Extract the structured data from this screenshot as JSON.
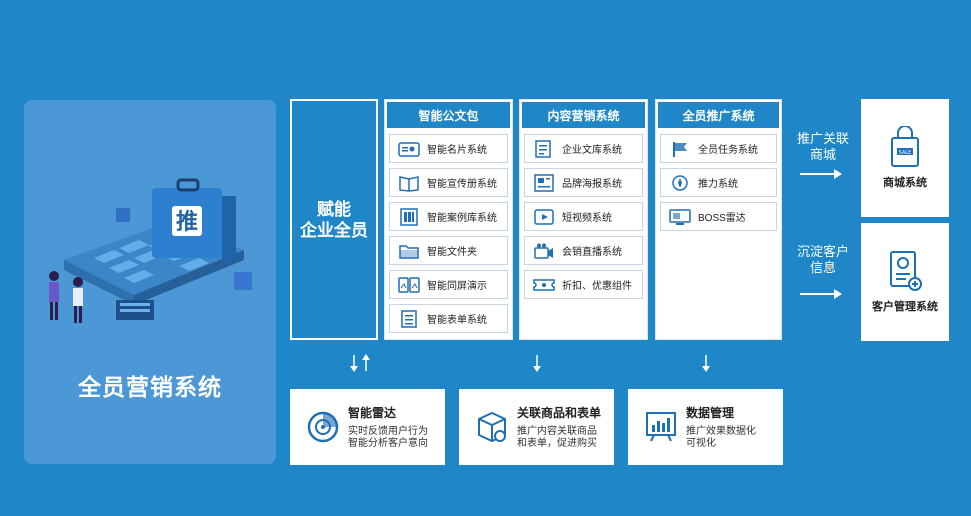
{
  "hero": {
    "title": "全员营销系统",
    "badge_char": "推"
  },
  "empower": {
    "text": "赋能\n企业全员"
  },
  "columns": [
    {
      "title": "智能公文包",
      "items": [
        {
          "label": "智能名片系统",
          "icon": "business-card-icon"
        },
        {
          "label": "智能宣传册系统",
          "icon": "brochure-icon"
        },
        {
          "label": "智能案例库系统",
          "icon": "case-library-icon"
        },
        {
          "label": "智能文件夹",
          "icon": "folder-icon"
        },
        {
          "label": "智能同屏演示",
          "icon": "screen-share-icon"
        },
        {
          "label": "智能表单系统",
          "icon": "form-icon"
        }
      ]
    },
    {
      "title": "内容营销系统",
      "items": [
        {
          "label": "企业文库系统",
          "icon": "document-library-icon"
        },
        {
          "label": "品牌海报系统",
          "icon": "poster-icon"
        },
        {
          "label": "短视频系统",
          "icon": "video-icon"
        },
        {
          "label": "会销直播系统",
          "icon": "live-camera-icon"
        },
        {
          "label": "折扣、优惠组件",
          "icon": "coupon-icon"
        }
      ]
    },
    {
      "title": "全员推广系统",
      "items": [
        {
          "label": "全员任务系统",
          "icon": "flag-icon"
        },
        {
          "label": "推力系统",
          "icon": "rocket-icon"
        },
        {
          "label": "BOSS雷达",
          "icon": "monitor-icon"
        }
      ]
    }
  ],
  "flows": [
    {
      "label": "推广关联\n商城"
    },
    {
      "label": "沉淀客户\n信息"
    }
  ],
  "systems": [
    {
      "label": "商城系统",
      "icon": "shopping-bag-icon"
    },
    {
      "label": "客户管理系统",
      "icon": "customer-profile-icon"
    }
  ],
  "cards": [
    {
      "title": "智能雷达",
      "desc": "实时反馈用户行为\n智能分析客户意向",
      "icon": "radar-icon"
    },
    {
      "title": "关联商品和表单",
      "desc": "推广内容关联商品\n和表单，促进购买",
      "icon": "package-icon"
    },
    {
      "title": "数据管理",
      "desc": "推广效果数据化\n可视化",
      "icon": "data-chart-icon"
    }
  ],
  "colors": {
    "background": "#1f87c8",
    "panel": "#4c97d6",
    "icon_blue": "#1f6fb5"
  }
}
